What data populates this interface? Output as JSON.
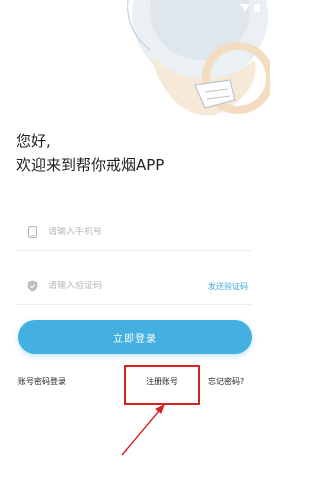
{
  "greeting": {
    "line1": "您好,",
    "line2": "欢迎来到帮你戒烟APP"
  },
  "phone": {
    "placeholder": "请输入手机号",
    "icon": "phone-icon"
  },
  "code": {
    "placeholder": "请输入验证码",
    "icon": "shield-icon",
    "send_label": "发送验证码"
  },
  "login_button": "立即登录",
  "links": {
    "password_login": "账号密码登录",
    "register": "注册账号",
    "forgot": "忘记密码?"
  },
  "colors": {
    "accent": "#44b0e0",
    "link": "#3fa7d7",
    "annotation": "#d32323"
  }
}
